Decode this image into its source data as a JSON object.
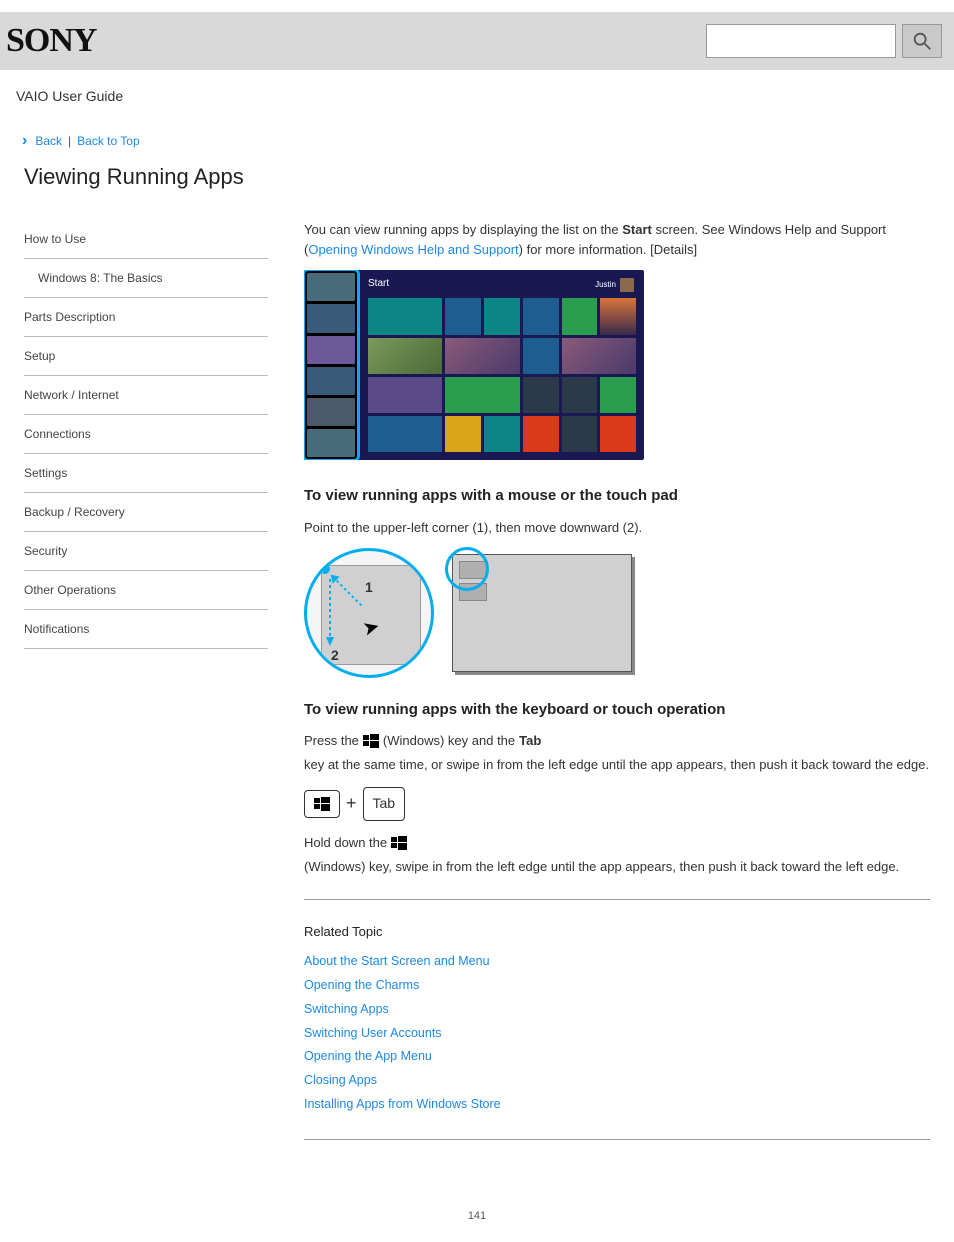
{
  "header": {
    "logo": "SONY",
    "search_placeholder": ""
  },
  "doc_title": "VAIO User Guide",
  "breadcrumb": {
    "back_label": "Back",
    "top_label": "Back to Top"
  },
  "page_heading": "Viewing Running Apps",
  "sidebar": {
    "items": [
      {
        "label": "How to Use"
      },
      {
        "label": "Windows 8: The Basics",
        "sub": false
      },
      {
        "label": "Parts Description"
      },
      {
        "label": "Setup"
      },
      {
        "label": "Network / Internet"
      },
      {
        "label": "Connections"
      },
      {
        "label": "Settings"
      },
      {
        "label": "Backup / Recovery"
      },
      {
        "label": "Security"
      },
      {
        "label": "Other Operations"
      },
      {
        "label": "Notifications"
      }
    ]
  },
  "content": {
    "intro1": "You can view running apps by displaying the list on the ",
    "intro1_bold": "Start",
    "intro1_tail": " screen. See Windows Help and Support (",
    "intro1_link": "Opening Windows Help and Support",
    "intro1_end": ") for more information. [Details]",
    "fig1_start_label": "Start",
    "fig1_user": "Justin",
    "mouse_head": "To view running apps with a mouse or the touch pad",
    "mouse_body": "Point to the upper-left corner (1), then move downward (2).",
    "kb_head": "To view running apps with the keyboard or touch operation",
    "kb_line_pre": "Press the ",
    "kb_win": " (Windows) key and the ",
    "kb_tab": "Tab",
    "kb_line_post": " key at the same time, or swipe in from the left edge until the app appears, then push it back toward the edge.",
    "hold_pre": "Hold down the ",
    "hold_post": " (Windows) key, swipe in from the left edge until the app appears, then push it back toward the left edge.",
    "tab_label": "Tab",
    "related_head": "Related Topic",
    "related_links": [
      "About the Start Screen and Menu",
      "Opening the Charms",
      "Switching Apps",
      "Switching User Accounts",
      "Opening the App Menu",
      "Closing Apps",
      "Installing Apps from Windows Store"
    ]
  },
  "page_number": "141"
}
